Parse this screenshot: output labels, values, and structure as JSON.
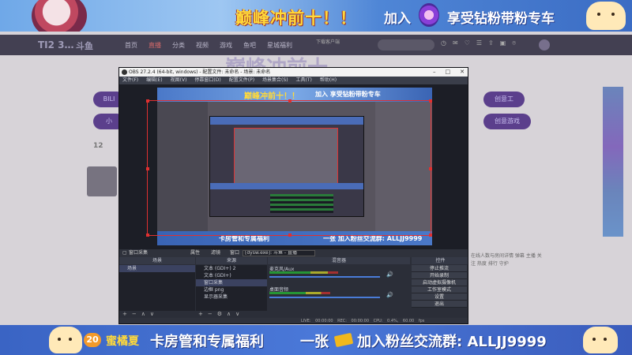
{
  "top_banner": {
    "headline": "巅峰冲前十！！",
    "join": "加入",
    "perk": "享受钻粉带粉专车"
  },
  "site": {
    "logo": "TI2 3…",
    "logo2": "斗鱼",
    "nav": [
      "首页",
      "直播",
      "分类",
      "视频",
      "游戏",
      "鱼吧",
      "星城福利"
    ],
    "download": "下载客户端",
    "title": "巅峰冲前十",
    "pills_left": [
      "BILI",
      "小"
    ],
    "pills_right": [
      "创意工",
      "创意游戏"
    ],
    "count": "12",
    "text_col": "在线人数与房间详情\n弹幕 主播 关注\n热度 排行 守护"
  },
  "obs": {
    "title": "OBS 27.2.4 (64-bit, windows) - 配置文件: 未命名 - 场景: 未命名",
    "menu": [
      "文件(F)",
      "编辑(E)",
      "视图(V)",
      "停靠窗口(D)",
      "配置文件(P)",
      "场景集合(S)",
      "工具(T)",
      "帮助(H)"
    ],
    "capture": {
      "banner_top": "巅峰冲前十！！",
      "banner_top_join": "加入 享受钻粉带粉专车",
      "banner_bottom": "卡房管和专属福利",
      "banner_bottom_join": "一张 加入粉丝交流群: ALLJJ9999"
    },
    "source_toolbar": {
      "window": "窗口采集",
      "properties": "属性",
      "filters": "滤镜",
      "window_label": "窗口",
      "window_value": "[dysw.exe]: 斗鱼 - 直播"
    },
    "docks": {
      "scenes": "场景",
      "sources": "来源",
      "mixer": "混音器",
      "controls": "控件"
    },
    "scenes": [
      "场景"
    ],
    "sources": [
      "文本 (GDI+) 2",
      "文本 (GDI+)",
      "窗口采集",
      "边框 png",
      "显示器采集"
    ],
    "mixer_tracks": [
      {
        "name": "麦克风/Aux",
        "level": 0.62
      },
      {
        "name": "桌面音频",
        "level": 0.55
      }
    ],
    "controls": [
      "停止推流",
      "开始录制",
      "启动虚拟摄像机",
      "工作室模式",
      "设置",
      "退出"
    ],
    "status": "LIVE: 00:00:00   REC: 00:00:00   CPU: 0.4%, 60.00 fps"
  },
  "bottom_banner": {
    "badge": "20",
    "name": "蜜橘夏",
    "perk": "卡房管和专属福利",
    "one": "一张",
    "join": "加入粉丝交流群: ALLJJ9999"
  }
}
